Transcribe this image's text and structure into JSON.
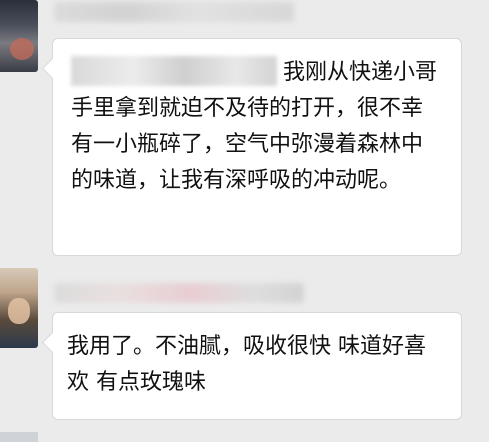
{
  "messages": [
    {
      "sender_avatar": "avatar-blurred",
      "text": "我刚从快递小哥手里拿到就迫不及待的打开，很不幸有一小瓶碎了，空气中弥漫着森林中的味道，让我有深呼吸的冲动呢。"
    },
    {
      "sender_avatar": "avatar-blurred",
      "text": "我用了。不油腻，吸收很快 味道好喜欢 有点玫瑰味"
    }
  ],
  "colors": {
    "background": "#ebebeb",
    "bubble": "#ffffff",
    "text": "#111111"
  }
}
